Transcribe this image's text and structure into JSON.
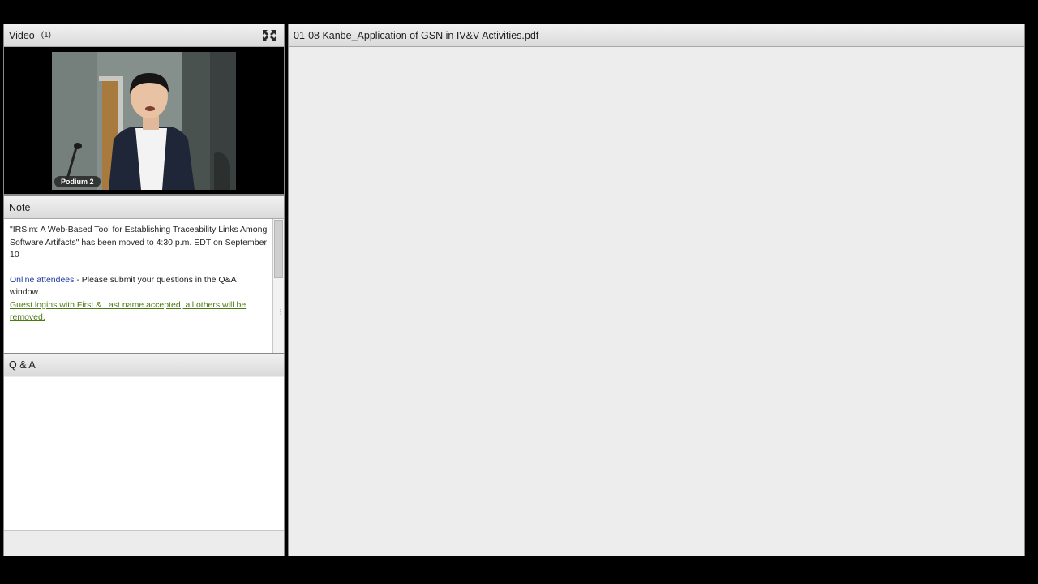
{
  "video_pod": {
    "title": "Video",
    "count": "(1)",
    "speaker_label": "Podium 2",
    "icons": {
      "fullscreen": "expand-arrows-icon"
    }
  },
  "note_pod": {
    "title": "Note",
    "paragraph1": "\"IRSim: A Web-Based Tool for Establishing Traceability Links Among Software Artifacts\" has been moved to 4:30 p.m. EDT on September 10",
    "online_attendees": "Online attendees",
    "online_rest": " - Please submit your questions in the Q&A window.",
    "guest_link": "Guest logins with First & Last name accepted, all others will be removed.",
    "colors": {
      "blue": "#1f3c9e",
      "green": "#4c7a12"
    }
  },
  "qa_pod": {
    "title": "Q & A"
  },
  "share_pod": {
    "title": "01-08 Kanbe_Application of GSN in IV&V Activities.pdf"
  }
}
